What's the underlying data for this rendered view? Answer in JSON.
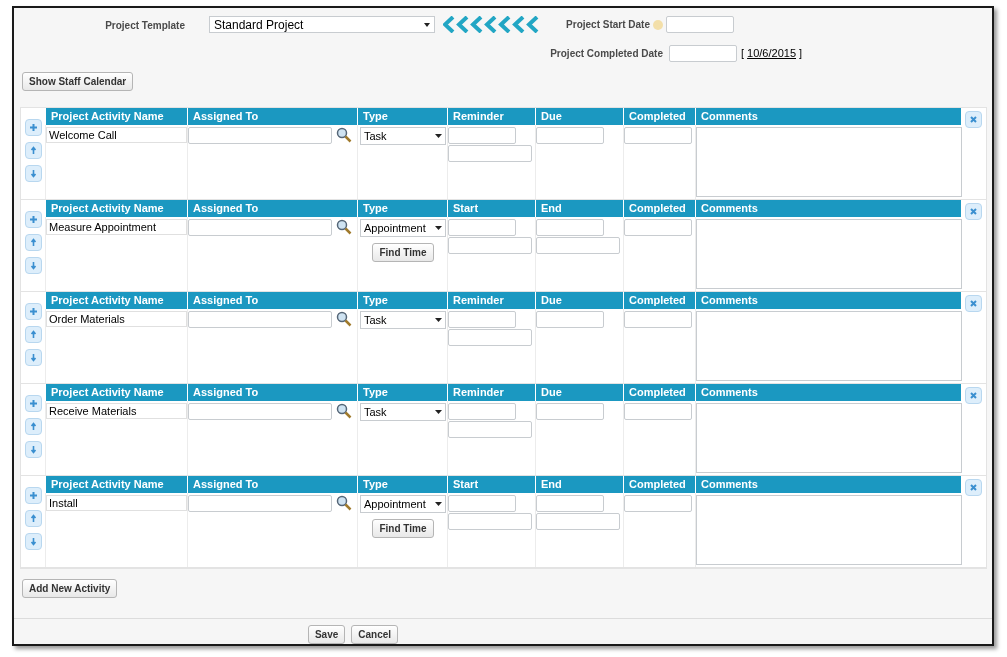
{
  "header": {
    "template_label": "Project Template",
    "template_value": "Standard Project",
    "start_date_label": "Project Start Date",
    "completed_date_label": "Project Completed Date",
    "completed_date_bracket_open": "[",
    "completed_date_link": "10/6/2015",
    "completed_date_bracket_close": "]"
  },
  "show_calendar_button": "Show Staff Calendar",
  "activities": [
    {
      "kind": "task",
      "columns": [
        "Project Activity Name",
        "Assigned To",
        "Type",
        "Reminder",
        "Due",
        "Completed",
        "Comments"
      ],
      "name": "Welcome Call",
      "type": "Task"
    },
    {
      "kind": "appointment",
      "columns": [
        "Project Activity Name",
        "Assigned To",
        "Type",
        "Start",
        "End",
        "Completed",
        "Comments"
      ],
      "name": "Measure Appointment",
      "type": "Appointment",
      "find_time": "Find Time"
    },
    {
      "kind": "task",
      "columns": [
        "Project Activity Name",
        "Assigned To",
        "Type",
        "Reminder",
        "Due",
        "Completed",
        "Comments"
      ],
      "name": "Order Materials",
      "type": "Task"
    },
    {
      "kind": "task",
      "columns": [
        "Project Activity Name",
        "Assigned To",
        "Type",
        "Reminder",
        "Due",
        "Completed",
        "Comments"
      ],
      "name": "Receive Materials",
      "type": "Task"
    },
    {
      "kind": "appointment",
      "columns": [
        "Project Activity Name",
        "Assigned To",
        "Type",
        "Start",
        "End",
        "Completed",
        "Comments"
      ],
      "name": "Install",
      "type": "Appointment",
      "find_time": "Find Time"
    }
  ],
  "add_button": "Add New Activity",
  "footer_buttons": [
    "Save",
    "Cancel"
  ]
}
